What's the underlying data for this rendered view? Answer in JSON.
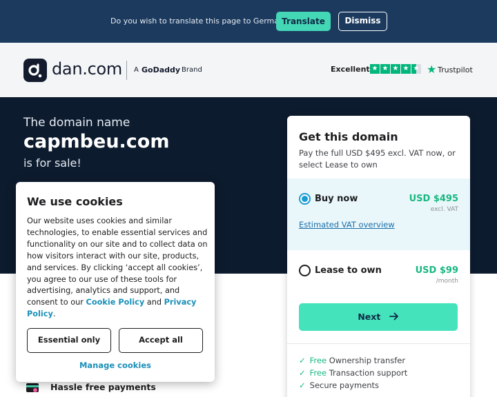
{
  "translate_bar": {
    "prompt": "Do you wish to translate this page to German?",
    "translate_label": "Translate",
    "dismiss_label": "Dismiss"
  },
  "header": {
    "logo_text": "dan.com",
    "brand_prefix": "A",
    "brand_name": "GoDaddy",
    "brand_suffix": "Brand",
    "trustpilot": {
      "rating_text": "Excellent",
      "stars": 4.5,
      "name": "Trustpilot"
    }
  },
  "hero": {
    "line1": "The domain name",
    "domain": "capmbeu.com",
    "line3": "is for sale!"
  },
  "purchase": {
    "title": "Get this domain",
    "subtitle": "Pay the full USD $495 excl. VAT now, or select Lease to own",
    "buy": {
      "label": "Buy now",
      "price": "USD $495",
      "note": "excl. VAT",
      "selected": true
    },
    "vat_link": "Estimated VAT overview",
    "lease": {
      "label": "Lease to own",
      "price": "USD $99",
      "note": "/month",
      "selected": false
    },
    "next_label": "Next",
    "features": [
      {
        "free": "Free",
        "text": "Ownership transfer"
      },
      {
        "free": "Free",
        "text": "Transaction support"
      },
      {
        "free": "",
        "text": "Secure payments"
      }
    ]
  },
  "benefits": {
    "hassle": "Hassle free payments"
  },
  "cookies": {
    "title": "We use cookies",
    "body": "Our website uses cookies and similar technologies, to enable essential services and functionality on our site and to collect data on how visitors interact with our site, products, and services. By clicking ‘accept all cookies’, you agree to our use of these tools for advertising, analytics and support, and consent to our",
    "cookie_policy": "Cookie Policy",
    "and": "and",
    "privacy_policy": "Privacy Policy",
    "period": ".",
    "essential_label": "Essential only",
    "accept_label": "Accept all",
    "manage_label": "Manage cookies"
  },
  "colors": {
    "accent_green": "#44d7b6",
    "hero_bg": "#0d1b2e",
    "translate_bar_bg": "#1c3a5e",
    "link_blue": "#1a8fb8"
  }
}
